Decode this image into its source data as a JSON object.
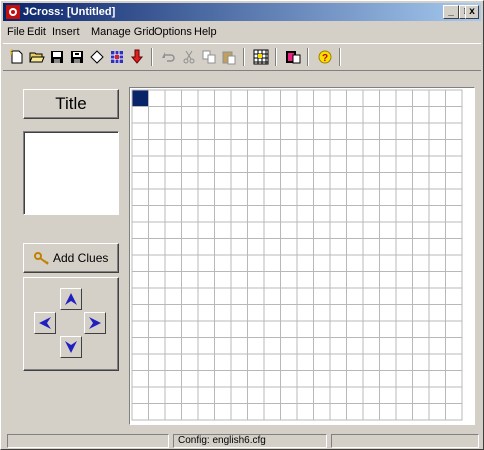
{
  "window": {
    "title": "JCross: [Untitled]"
  },
  "titlebar_buttons": {
    "minimize": "_",
    "maximize": "□",
    "close": "x"
  },
  "menu": [
    "File",
    "Edit",
    "Insert",
    "Manage Grid",
    "Options",
    "Help"
  ],
  "toolbar": {
    "tools": [
      "new-file-icon",
      "open-folder-icon",
      "save-icon",
      "save-as-icon",
      "clear-icon",
      "grid-pattern-icon",
      "down-arrow-icon",
      "undo-icon",
      "cut-icon",
      "copy-icon",
      "paste-icon",
      "grid-icon",
      "export-icon",
      "help-icon"
    ]
  },
  "left_panel": {
    "title_button": "Title",
    "add_clues_button": "Add Clues"
  },
  "grid": {
    "rows": 20,
    "cols": 20,
    "selected_cell": [
      0,
      0
    ],
    "selected_color": "#0a246a"
  },
  "statusbar": {
    "panes": [
      "",
      "Config: english6.cfg",
      ""
    ]
  }
}
